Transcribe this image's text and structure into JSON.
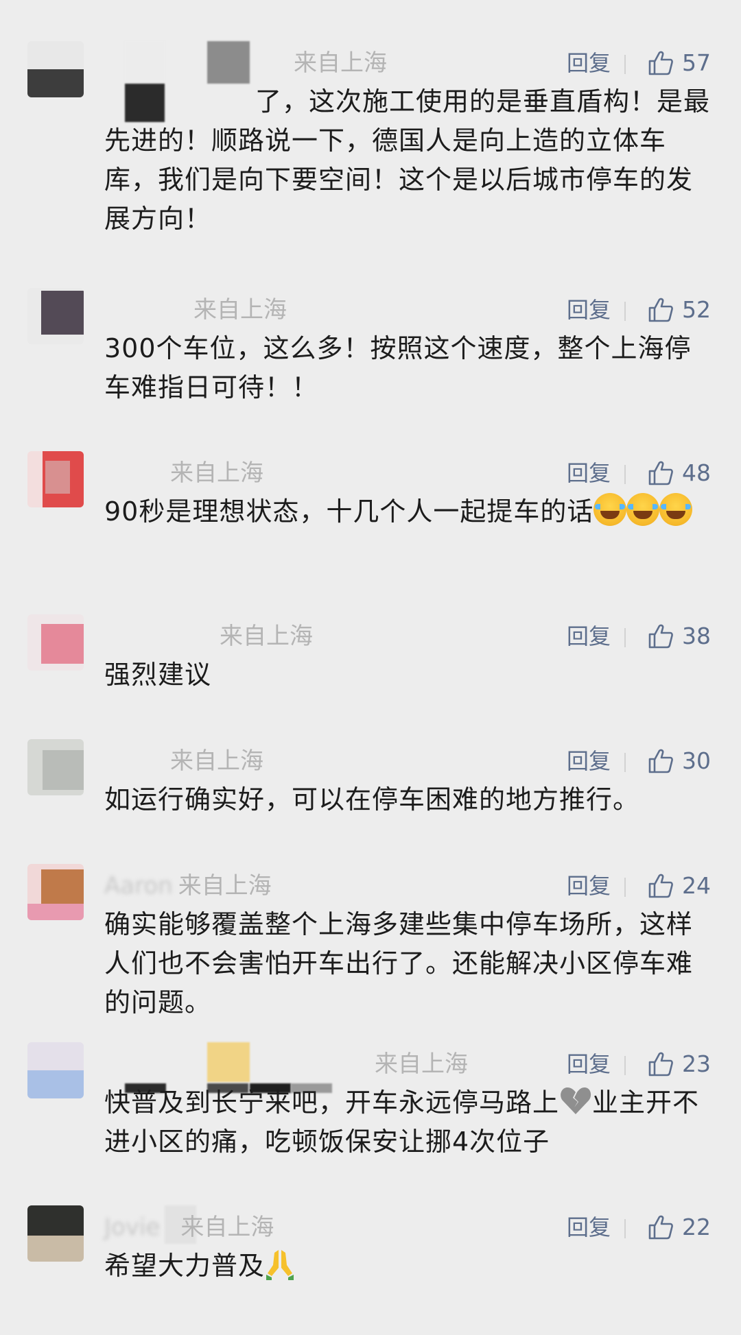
{
  "colors": {
    "background": "#ededed",
    "meta_gray": "#b4b4b4",
    "action_blue": "#5d6e8c",
    "text": "#1c1c1c"
  },
  "icons": {
    "like": "thumbs-up-outline-icon",
    "laugh_cry": "face-with-tears-of-joy-emoji",
    "broken_heart": "broken-heart-emoji",
    "pray": "folded-hands-emoji"
  },
  "reply_label": "回复",
  "comments": [
    {
      "name": "",
      "location": "来自上海",
      "likes": "57",
      "text": "了，这次施工使用的是垂直盾构！是最先进的！顺路说一下，德国人是向上造的立体车库，我们是向下要空间！这个是以后城市停车的发展方向！"
    },
    {
      "name": "",
      "location": "来自上海",
      "likes": "52",
      "text": "300个车位，这么多！按照这个速度，整个上海停车难指日可待！！"
    },
    {
      "name": "",
      "location": "来自上海",
      "likes": "48",
      "text": "90秒是理想状态，十几个人一起提车的话"
    },
    {
      "name": "",
      "location": "来自上海",
      "likes": "38",
      "text": "强烈建议"
    },
    {
      "name": "",
      "location": "来自上海",
      "likes": "30",
      "text": "如运行确实好，可以在停车困难的地方推行。"
    },
    {
      "name": "Aaron",
      "location": "来自上海",
      "likes": "24",
      "text": "确实能够覆盖整个上海多建些集中停车场所，这样人们也不会害怕开车出行了。还能解决小区停车难的问题。"
    },
    {
      "name": "",
      "location": "来自上海",
      "likes": "23",
      "text_a": "快普及到长宁来吧，开车永远停马路上",
      "text_b": "业主开不进小区的痛，吃顿饭保安让挪4次位子"
    },
    {
      "name": "Jovie",
      "location": "来自上海",
      "likes": "22",
      "text": "希望大力普及"
    }
  ]
}
